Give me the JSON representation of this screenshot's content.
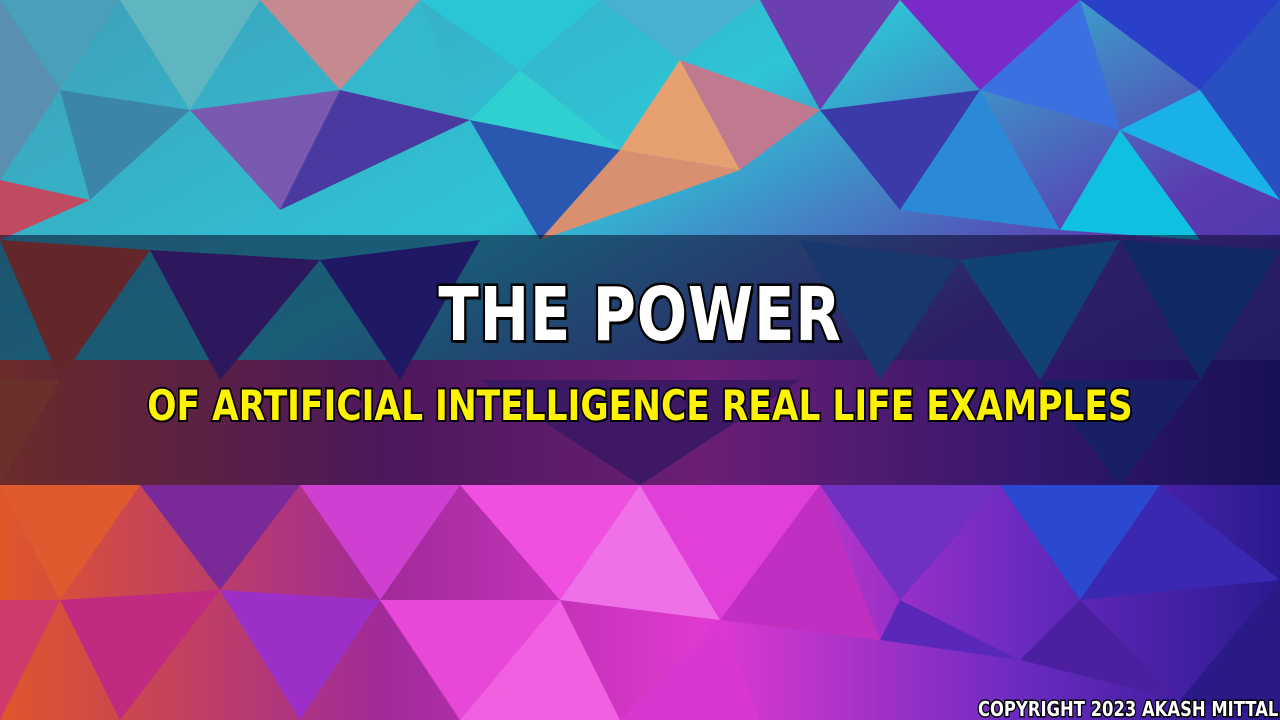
{
  "title": "THE POWER",
  "subtitle": "OF ARTIFICIAL INTELLIGENCE REAL LIFE EXAMPLES",
  "copyright": "COPYRIGHT 2023 AKASH MITTAL",
  "colors": {
    "title_text": "#ffffff",
    "subtitle_text": "#fff200",
    "text_outline": "#000000",
    "band_overlay": "#0a0a28"
  }
}
